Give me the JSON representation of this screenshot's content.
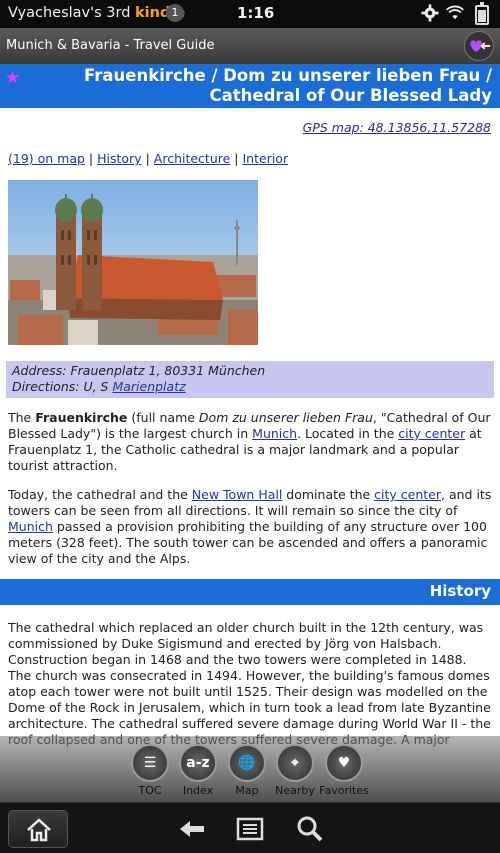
{
  "status": {
    "owner": "Vyacheslav's 3rd",
    "brand": "kindle",
    "notifications": "1",
    "time": "1:16"
  },
  "appbar": {
    "title": "Munich & Bavaria - Travel Guide"
  },
  "article": {
    "title": "Frauenkirche / Dom zu unserer lieben Frau / Cathedral of Our Blessed Lady",
    "gps": "GPS map: 48.13856,11.57288",
    "links": [
      "(19) on map",
      "History",
      "Architecture",
      "Interior"
    ],
    "address_line": "Address: Frauenplatz 1, 80331 München",
    "directions_prefix": "Directions: U, S ",
    "directions_link": "Marienplatz",
    "p1": {
      "t1": "The ",
      "b1": "Frauenkirche",
      "t2": " (full name ",
      "i1": "Dom zu unserer lieben Frau",
      "t3": ", \"Cathedral of Our Blessed Lady\") is the largest church in ",
      "l1": "Munich",
      "t4": ". Located in the ",
      "l2": "city center",
      "t5": " at Frauenplatz 1, the Catholic cathedral is a major landmark and a popular tourist attraction."
    },
    "p2": {
      "t1": "Today, the cathedral and the ",
      "l1": "New Town Hall",
      "t2": " dominate the ",
      "l2": "city center",
      "t3": ", and its towers can be seen from all directions. It will remain so since the city of ",
      "l3": "Munich",
      "t4": " passed a provision prohibiting the building of any structure over 100 meters (328 feet). The south tower can be ascended and offers a panoramic view of the city and the Alps."
    },
    "history_heading": "History",
    "p3": "The cathedral which replaced an older church built in the 12th century, was commissioned by Duke Sigismund and erected by Jörg von Halsbach. Construction began in 1468 and the two towers were completed in 1488. The church was consecrated in 1494. However, the building's famous domes atop each tower were not built until 1525. Their design was modelled on the Dome of the Rock in Jerusalem, which in turn took a lead from late Byzantine architecture. The cathedral suffered severe damage during World War II - the roof collapsed and one of the towers suffered severe damage. A major"
  },
  "navbar": {
    "items": [
      {
        "label": "TOC",
        "glyph": "☰"
      },
      {
        "label": "Index",
        "glyph": "a-z"
      },
      {
        "label": "Map",
        "glyph": "🌐"
      },
      {
        "label": "Nearby",
        "glyph": "⌖"
      },
      {
        "label": "Favorites",
        "glyph": "♥"
      }
    ]
  },
  "colors": {
    "header_blue": "#1a6dd6",
    "address_bg": "#c7c7f1",
    "link": "#2233aa",
    "star": "#e83cff",
    "kindle_orange": "#f7a01a"
  }
}
